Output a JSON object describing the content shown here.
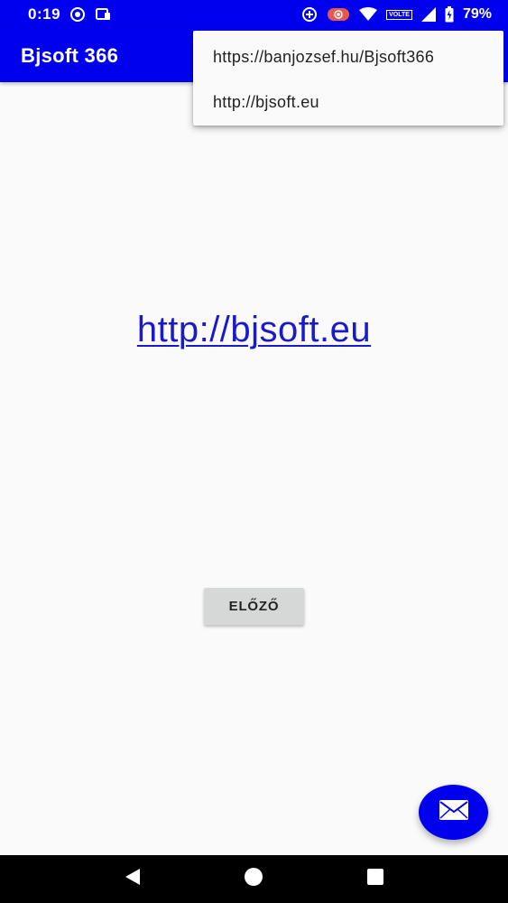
{
  "status_bar": {
    "time": "0:19",
    "volte_label": "VOLTE",
    "battery_percent": "79%",
    "icons": [
      "screen-record-icon",
      "cast-icon",
      "data-saver-icon",
      "record-icon",
      "wifi-icon",
      "volte-icon",
      "signal-icon",
      "battery-icon"
    ]
  },
  "app_bar": {
    "title": "Bjsoft 366"
  },
  "overflow_menu": {
    "items": [
      {
        "label": "https://banjozsef.hu/Bjsoft366"
      },
      {
        "label": "http://bjsoft.eu"
      }
    ]
  },
  "main": {
    "link_text": "http://bjsoft.eu",
    "prev_button_label": "ELŐZŐ"
  },
  "fab": {
    "icon": "mail-icon"
  },
  "nav_bar": {
    "icons": [
      "back-icon",
      "home-icon",
      "recents-icon"
    ]
  },
  "colors": {
    "primary": "#0000ee",
    "link": "#1a1ac8",
    "background": "#fafafa",
    "button": "#d6d7d7"
  }
}
